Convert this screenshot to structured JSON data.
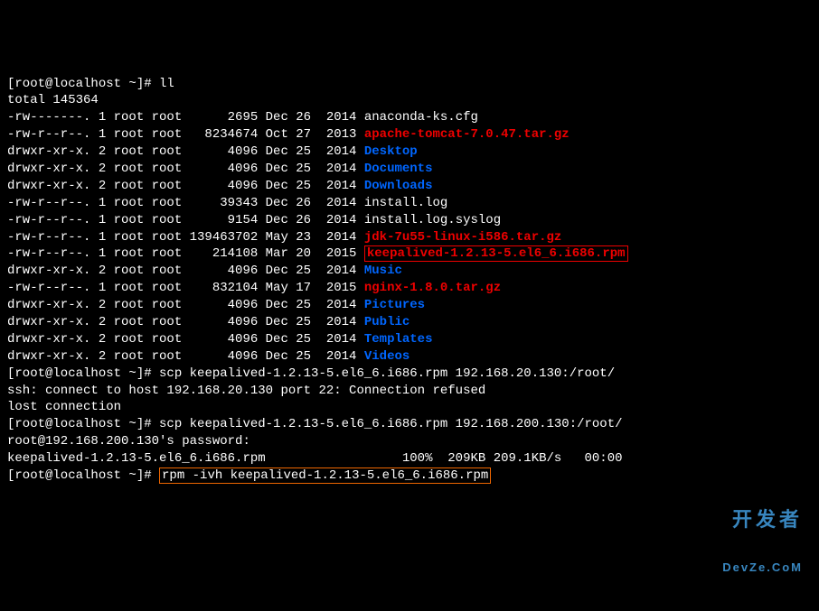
{
  "prompt1": "[root@localhost ~]# ",
  "cmd_ll": "ll",
  "total": "total 145364",
  "files": [
    {
      "perm": "-rw-------.",
      "links": "1",
      "owner": "root",
      "group": "root",
      "size": "     2695",
      "date": "Dec 26  2014",
      "name": "anaconda-ks.cfg",
      "color": "white"
    },
    {
      "perm": "-rw-r--r--.",
      "links": "1",
      "owner": "root",
      "group": "root",
      "size": "  8234674",
      "date": "Oct 27  2013",
      "name": "apache-tomcat-7.0.47.tar.gz",
      "color": "red"
    },
    {
      "perm": "drwxr-xr-x.",
      "links": "2",
      "owner": "root",
      "group": "root",
      "size": "     4096",
      "date": "Dec 25  2014",
      "name": "Desktop",
      "color": "blue"
    },
    {
      "perm": "drwxr-xr-x.",
      "links": "2",
      "owner": "root",
      "group": "root",
      "size": "     4096",
      "date": "Dec 25  2014",
      "name": "Documents",
      "color": "blue"
    },
    {
      "perm": "drwxr-xr-x.",
      "links": "2",
      "owner": "root",
      "group": "root",
      "size": "     4096",
      "date": "Dec 25  2014",
      "name": "Downloads",
      "color": "blue"
    },
    {
      "perm": "-rw-r--r--.",
      "links": "1",
      "owner": "root",
      "group": "root",
      "size": "    39343",
      "date": "Dec 26  2014",
      "name": "install.log",
      "color": "white"
    },
    {
      "perm": "-rw-r--r--.",
      "links": "1",
      "owner": "root",
      "group": "root",
      "size": "     9154",
      "date": "Dec 26  2014",
      "name": "install.log.syslog",
      "color": "white"
    },
    {
      "perm": "-rw-r--r--.",
      "links": "1",
      "owner": "root",
      "group": "root",
      "size": "139463702",
      "date": "May 23  2014",
      "name": "jdk-7u55-linux-i586.tar.gz",
      "color": "red"
    },
    {
      "perm": "-rw-r--r--.",
      "links": "1",
      "owner": "root",
      "group": "root",
      "size": "   214108",
      "date": "Mar 20  2015",
      "name": "keepalived-1.2.13-5.el6_6.i686.rpm",
      "color": "red",
      "highlight": "red"
    },
    {
      "perm": "drwxr-xr-x.",
      "links": "2",
      "owner": "root",
      "group": "root",
      "size": "     4096",
      "date": "Dec 25  2014",
      "name": "Music",
      "color": "blue"
    },
    {
      "perm": "-rw-r--r--.",
      "links": "1",
      "owner": "root",
      "group": "root",
      "size": "   832104",
      "date": "May 17  2015",
      "name": "nginx-1.8.0.tar.gz",
      "color": "red"
    },
    {
      "perm": "drwxr-xr-x.",
      "links": "2",
      "owner": "root",
      "group": "root",
      "size": "     4096",
      "date": "Dec 25  2014",
      "name": "Pictures",
      "color": "blue"
    },
    {
      "perm": "drwxr-xr-x.",
      "links": "2",
      "owner": "root",
      "group": "root",
      "size": "     4096",
      "date": "Dec 25  2014",
      "name": "Public",
      "color": "blue"
    },
    {
      "perm": "drwxr-xr-x.",
      "links": "2",
      "owner": "root",
      "group": "root",
      "size": "     4096",
      "date": "Dec 25  2014",
      "name": "Templates",
      "color": "blue"
    },
    {
      "perm": "drwxr-xr-x.",
      "links": "2",
      "owner": "root",
      "group": "root",
      "size": "     4096",
      "date": "Dec 25  2014",
      "name": "Videos",
      "color": "blue"
    }
  ],
  "scp1": "scp keepalived-1.2.13-5.el6_6.i686.rpm 192.168.20.130:/root/",
  "ssh_err": "ssh: connect to host 192.168.20.130 port 22: Connection refused",
  "lost": "lost connection",
  "scp2": "scp keepalived-1.2.13-5.el6_6.i686.rpm 192.168.200.130:/root/",
  "pw_prompt": "root@192.168.200.130's password:",
  "scp_result": "keepalived-1.2.13-5.el6_6.i686.rpm                  100%  209KB 209.1KB/s   00:00",
  "rpm_cmd": "rpm -ivh keepalived-1.2.13-5.el6_6.i686.rpm",
  "watermark_top": "开发者",
  "watermark_sub": "DevZe.CoM"
}
